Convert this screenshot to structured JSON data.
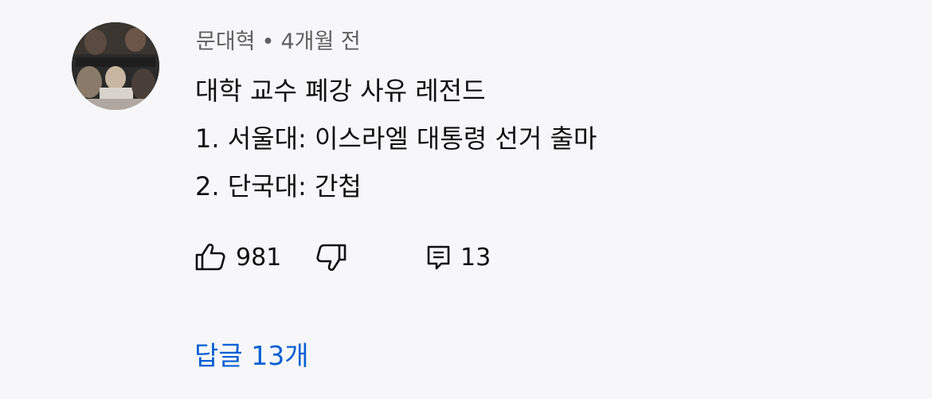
{
  "comment": {
    "author": "문대혁",
    "separator": "•",
    "time": "4개월 전",
    "lines": [
      "대학 교수 폐강 사유 레전드",
      "1. 서울대: 이스라엘 대통령 선거 출마",
      "2. 단국대: 간첩"
    ],
    "likes": "981",
    "reply_count": "13",
    "replies_label": "답글 13개",
    "avatar_icon": "user-avatar-photo",
    "icons": {
      "like": "thumbs-up-icon",
      "dislike": "thumbs-down-icon",
      "reply": "comment-icon"
    },
    "colors": {
      "background": "#f7f7f9",
      "text": "#0f0f0f",
      "meta": "#606060",
      "link": "#065fd4"
    }
  }
}
